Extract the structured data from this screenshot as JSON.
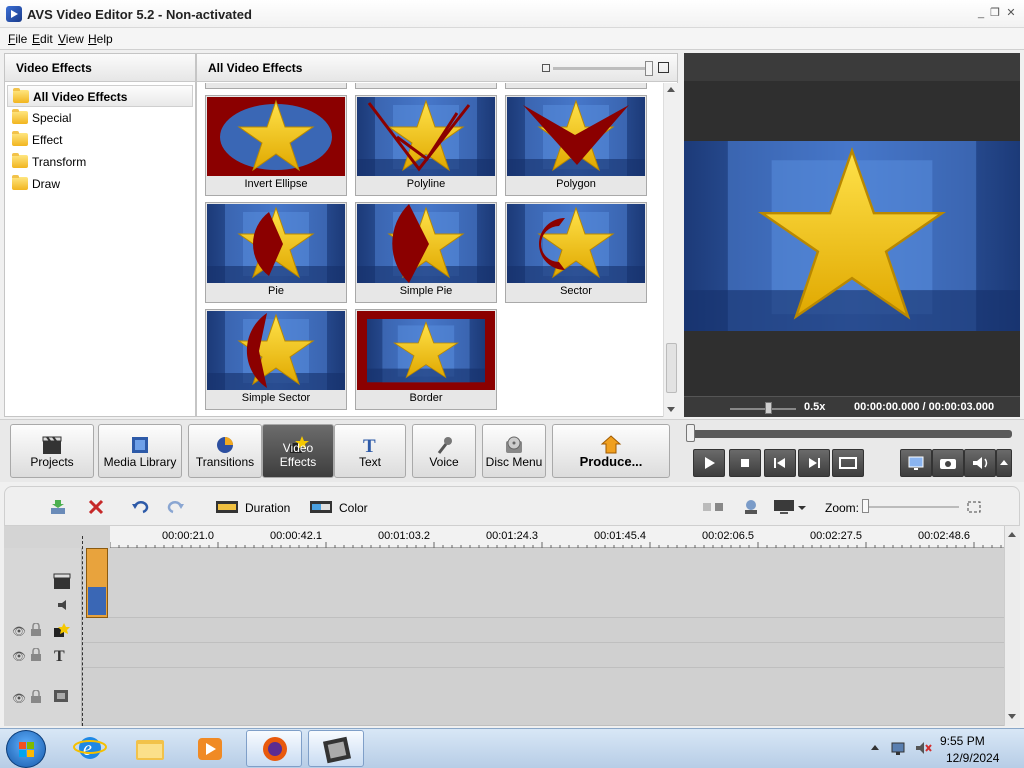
{
  "window": {
    "title": "AVS Video Editor 5.2 - Non-activated",
    "minimize_label": "_",
    "restore_label": "❐",
    "close_label": "✕"
  },
  "menu": {
    "items": [
      "File",
      "Edit",
      "View",
      "Help"
    ]
  },
  "left_panel": {
    "title": "Video Effects",
    "categories": [
      "All Video Effects",
      "Special",
      "Effect",
      "Transform",
      "Draw"
    ],
    "selected": "All Video Effects"
  },
  "effects_panel": {
    "title": "All Video Effects",
    "effects": [
      "Invert Ellipse",
      "Polyline",
      "Polygon",
      "Pie",
      "Simple Pie",
      "Sector",
      "Simple Sector",
      "Border"
    ]
  },
  "preview": {
    "speed": "0.5x",
    "current_time": "00:00:00.000",
    "separator": "/",
    "total_time": "00:00:03.000"
  },
  "toolbar": {
    "buttons": [
      "Projects",
      "Media Library",
      "Transitions",
      "Video Effects",
      "Text",
      "Voice",
      "Disc Menu",
      "Produce..."
    ],
    "active": "Video Effects"
  },
  "timeline_toolbar": {
    "duration_label": "Duration",
    "color_label": "Color",
    "zoom_label": "Zoom:"
  },
  "timeline": {
    "ruler_labels": [
      "00:00:21.0",
      "00:00:42.1",
      "00:01:03.2",
      "00:01:24.3",
      "00:01:45.4",
      "00:02:06.5",
      "00:02:27.5",
      "00:02:48.6"
    ]
  },
  "taskbar": {
    "time": "9:55 PM",
    "date": "12/9/2024"
  },
  "colors": {
    "effect_red": "#8b0000",
    "star_yellow": "#f5c800",
    "toolbar_active": "#4a4a4a"
  }
}
